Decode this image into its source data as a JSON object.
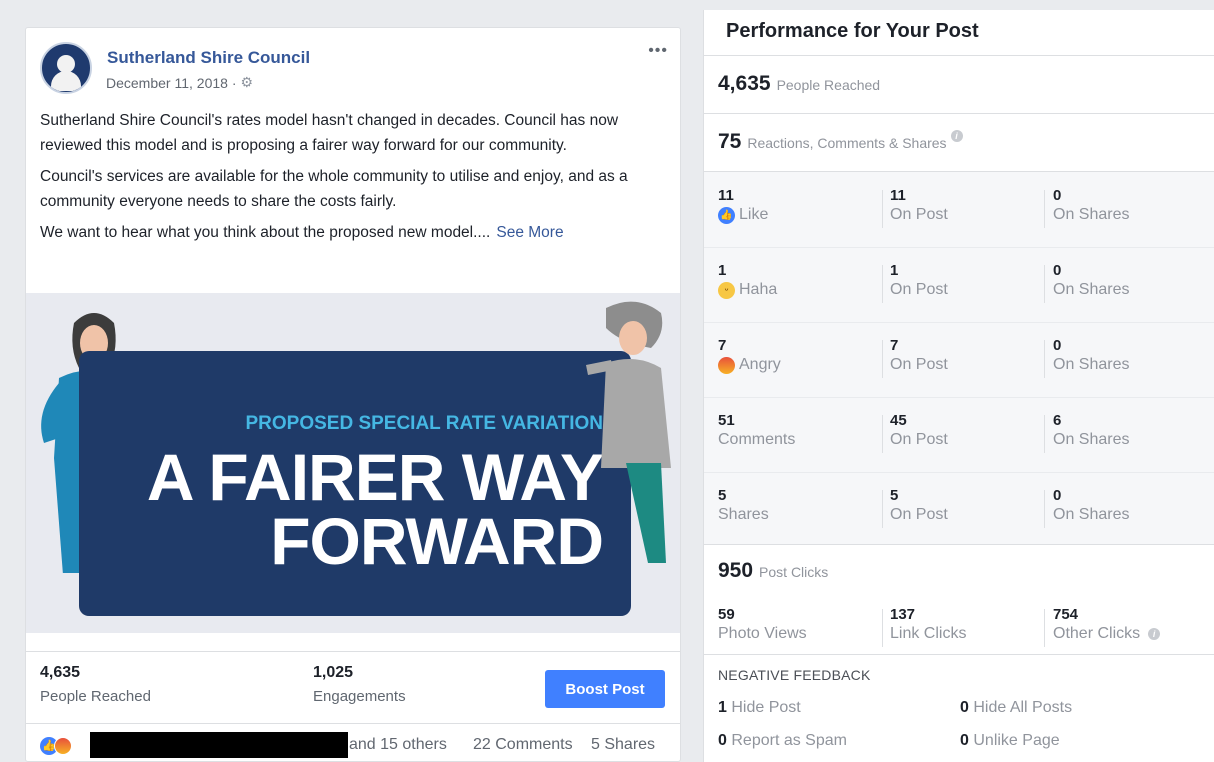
{
  "post": {
    "page_name": "Sutherland Shire Council",
    "date": "December 11, 2018 ·",
    "paragraphs": [
      "Sutherland Shire Council's rates model hasn't changed in decades. Council has now reviewed this model and is proposing a fairer way forward for our community.",
      "Council's services are available for the whole community to utilise and enjoy, and as a community everyone needs to share the costs fairly.",
      "We want to hear what you think about the proposed new model...."
    ],
    "see_more": "See More",
    "image": {
      "subtitle": "PROPOSED SPECIAL RATE VARIATION",
      "title_line1": "A FAIRER WAY",
      "title_line2": "FORWARD"
    },
    "stats": {
      "reached_value": "4,635",
      "reached_label": "People Reached",
      "engagements_value": "1,025",
      "engagements_label": "Engagements",
      "boost_label": "Boost Post"
    },
    "reactions_bar": {
      "others": "and 15 others",
      "comments": "22 Comments",
      "shares": "5 Shares"
    }
  },
  "panel": {
    "title": "Performance for Your Post",
    "people_reached": {
      "value": "4,635",
      "label": "People Reached"
    },
    "reactions_total": {
      "value": "75",
      "label": "Reactions, Comments & Shares"
    },
    "breakdown": [
      {
        "total": "11",
        "label": "Like",
        "icon": "like-icon",
        "on_post": "11",
        "on_post_label": "On Post",
        "on_shares": "0",
        "on_shares_label": "On Shares"
      },
      {
        "total": "1",
        "label": "Haha",
        "icon": "haha-icon",
        "on_post": "1",
        "on_post_label": "On Post",
        "on_shares": "0",
        "on_shares_label": "On Shares"
      },
      {
        "total": "7",
        "label": "Angry",
        "icon": "angry-icon",
        "on_post": "7",
        "on_post_label": "On Post",
        "on_shares": "0",
        "on_shares_label": "On Shares"
      },
      {
        "total": "51",
        "label": "Comments",
        "on_post": "45",
        "on_post_label": "On Post",
        "on_shares": "6",
        "on_shares_label": "On Shares"
      },
      {
        "total": "5",
        "label": "Shares",
        "on_post": "5",
        "on_post_label": "On Post",
        "on_shares": "0",
        "on_shares_label": "On Shares"
      }
    ],
    "post_clicks": {
      "value": "950",
      "label": "Post Clicks",
      "items": [
        {
          "value": "59",
          "label": "Photo Views"
        },
        {
          "value": "137",
          "label": "Link Clicks"
        },
        {
          "value": "754",
          "label": "Other Clicks"
        }
      ]
    },
    "negative_feedback": {
      "title": "NEGATIVE FEEDBACK",
      "items": [
        {
          "value": "1",
          "label": "Hide Post"
        },
        {
          "value": "0",
          "label": "Hide All Posts"
        },
        {
          "value": "0",
          "label": "Report as Spam"
        },
        {
          "value": "0",
          "label": "Unlike Page"
        }
      ]
    }
  },
  "colors": {
    "link": "#365899",
    "boost_button": "#4080ff",
    "banner": "#1f3a68",
    "banner_subtitle": "#45b7e3"
  }
}
